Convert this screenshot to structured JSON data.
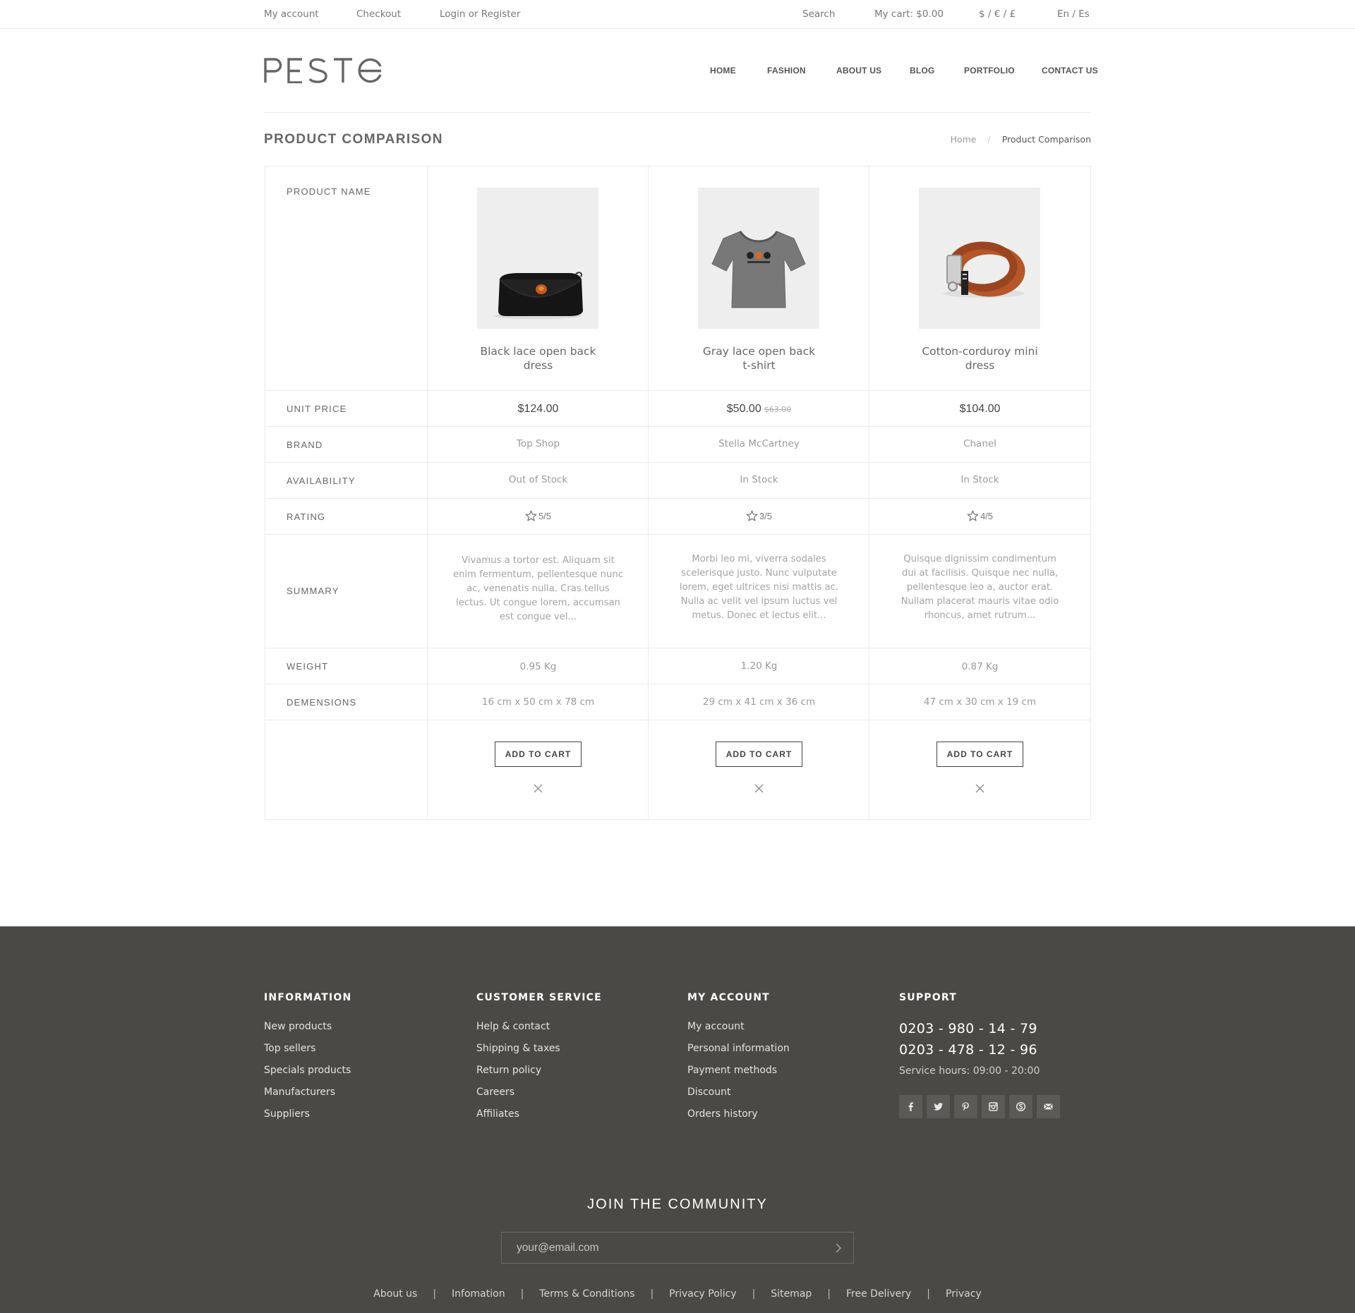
{
  "topbar": {
    "my_account": "My account",
    "checkout": "Checkout",
    "login": "Login or Register",
    "search": "Search",
    "cart": "My cart: $0.00",
    "currency": "$ / € / £",
    "language": "En / Es"
  },
  "brand": {
    "logo_text": "PESTO"
  },
  "nav": {
    "home": "HOME",
    "fashion": "FASHION",
    "about": "ABOUT US",
    "blog": "BLOG",
    "portfolio": "PORTFOLIO",
    "contact": "CONTACT US"
  },
  "page": {
    "title": "PRODUCT COMPARISON",
    "breadcrumb_home": "Home",
    "breadcrumb_sep": "/",
    "breadcrumb_current": "Product Comparison"
  },
  "labels": {
    "name": "PRODUCT NAME",
    "price": "UNIT PRICE",
    "brand": "BRAND",
    "availability": "AVAILABILITY",
    "rating": "RATING",
    "summary": "SUMMARY",
    "weight": "WEIGHT",
    "dimensions": "DEMENSIONS"
  },
  "products": [
    {
      "name_line1": "Black lace open back",
      "name_line2": "dress",
      "price": "$124.00",
      "old_price": "",
      "brand": "Top Shop",
      "availability": "Out of Stock",
      "rating": "5/5",
      "summary": "Vivamus a tortor est. Aliquam sit enim fermentum, pellentesque nunc ac, venenatis nulla. Cras tellus lectus. Ut congue lorem, accumsan est congue vel...",
      "weight": "0.95 Kg",
      "dimensions": "16 cm x 50 cm x 78 cm",
      "cta": "ADD TO CART",
      "image_icon": "black-clutch-bag"
    },
    {
      "name_line1": "Gray lace open back",
      "name_line2": "t-shirt",
      "price": "$50.00",
      "old_price": "$63.00",
      "brand": "Stella McCartney",
      "availability": "In Stock",
      "rating": "3/5",
      "summary": "Morbi leo mi, viverra sodales scelerisque justo. Nunc vulputate lorem, eget ultrices nisi mattis ac. Nulla ac velit vel ipsum luctus vel metus. Donec et lectus elit...",
      "weight": "1.20 Kg",
      "dimensions": "29 cm x 41 cm x 36 cm",
      "cta": "ADD TO CART",
      "image_icon": "gray-tshirt"
    },
    {
      "name_line1": "Cotton-corduroy mini",
      "name_line2": "dress",
      "price": "$104.00",
      "old_price": "",
      "brand": "Chanel",
      "availability": "In Stock",
      "rating": "4/5",
      "summary": "Quisque dignissim condimentum dui at facilisis. Quisque nec nulla, pellentesque leo a, auctor erat. Nullam placerat mauris vitae odio rhoncus, amet rutrum...",
      "weight": "0.87 Kg",
      "dimensions": "47 cm x 30 cm x 19 cm",
      "cta": "ADD TO CART",
      "image_icon": "brown-leather-belt"
    }
  ],
  "footer": {
    "information": {
      "title": "INFORMATION",
      "links": [
        "New products",
        "Top sellers",
        "Specials products",
        "Manufacturers",
        "Suppliers"
      ]
    },
    "customer_service": {
      "title": "CUSTOMER SERVICE",
      "links": [
        "Help & contact",
        "Shipping & taxes",
        "Return policy",
        "Careers",
        "Affiliates"
      ]
    },
    "my_account": {
      "title": "MY ACCOUNT",
      "links": [
        "My account",
        "Personal information",
        "Payment methods",
        "Discount",
        "Orders history"
      ]
    },
    "support": {
      "title": "SUPPORT",
      "phone1": "0203 - 980 - 14 - 79",
      "phone2": "0203 - 478 - 12 - 96",
      "hours": "Service hours: 09:00 - 20:00",
      "social_icons": [
        "facebook-icon",
        "twitter-icon",
        "pinterest-icon",
        "instagram-icon",
        "skype-icon",
        "mail-icon"
      ]
    },
    "join_title": "JOIN THE COMMUNITY",
    "email_placeholder": "your@email.com",
    "bottom_links": [
      "About us",
      "Infomation",
      "Terms & Conditions",
      "Privacy Policy",
      "Sitemap",
      "Free Delivery",
      "Privacy"
    ],
    "bottom_sep": "|"
  },
  "colors": {
    "footer_bg": "#4b4945",
    "text": "#555555",
    "muted": "#999999",
    "border": "#ebebeb"
  }
}
